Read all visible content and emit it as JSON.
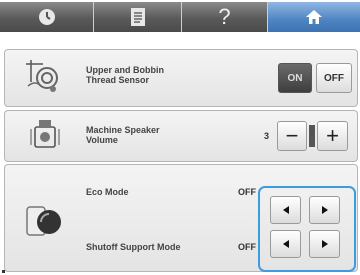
{
  "topbar": {
    "tabs": [
      {
        "icon": "clock-icon",
        "active": false
      },
      {
        "icon": "document-icon",
        "active": false
      },
      {
        "icon": "help-icon",
        "label": "?",
        "active": false
      },
      {
        "icon": "home-icon",
        "active": true
      }
    ]
  },
  "thread_sensor": {
    "label_line1": "Upper and Bobbin",
    "label_line2": "Thread Sensor",
    "on_label": "ON",
    "off_label": "OFF",
    "value": "ON"
  },
  "speaker": {
    "label_line1": "Machine Speaker",
    "label_line2": "Volume",
    "level": "3",
    "minus_label": "−",
    "plus_label": "+"
  },
  "eco_mode": {
    "label": "Eco Mode",
    "value": "OFF"
  },
  "shutoff_mode": {
    "label": "Shutoff Support Mode",
    "value": "OFF"
  },
  "colors": {
    "tab_active": "#4f84c2",
    "highlight_box": "#3d9be0"
  }
}
